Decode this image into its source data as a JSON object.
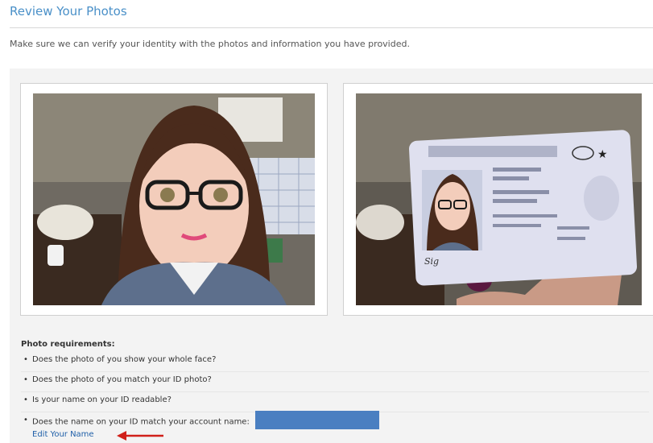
{
  "page": {
    "title": "Review Your Photos",
    "subtitle": "Make sure we can verify your identity with the photos and information you have provided."
  },
  "photos": {
    "selfie_icon": "user-selfie-photo",
    "id_icon": "id-card-photo"
  },
  "requirements": {
    "title": "Photo requirements:",
    "items": [
      "Does the photo of you show your whole face?",
      "Does the photo of you match your ID photo?",
      "Is your name on your ID readable?",
      "Does the name on your ID match your account name:"
    ],
    "edit_link": "Edit Your Name"
  },
  "colors": {
    "title": "#4a90c8",
    "link": "#1f5fa8",
    "name_redaction": "#4a7fc1",
    "arrow": "#d0201a"
  }
}
